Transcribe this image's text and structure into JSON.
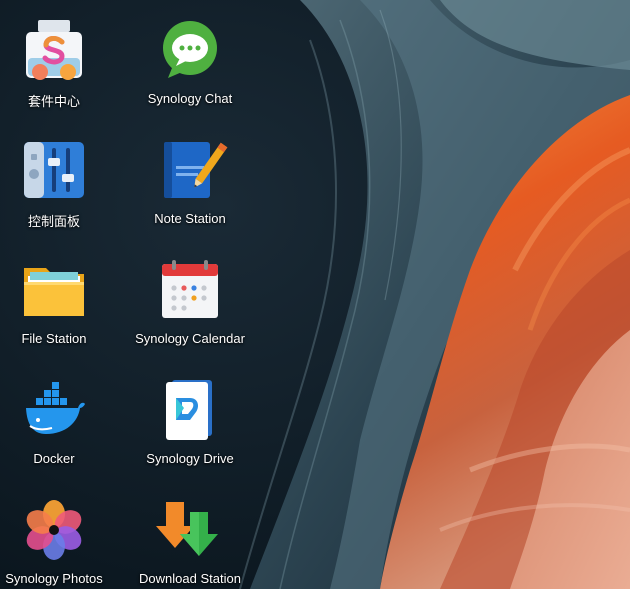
{
  "desktop": {
    "apps": [
      {
        "label": "套件中心",
        "icon": "package-center-icon"
      },
      {
        "label": "Synology Chat",
        "icon": "chat-bubble-icon"
      },
      {
        "label": "控制面板",
        "icon": "control-panel-sliders-icon"
      },
      {
        "label": "Note Station",
        "icon": "notebook-pencil-icon"
      },
      {
        "label": "File Station",
        "icon": "folder-icon"
      },
      {
        "label": "Synology Calendar",
        "icon": "calendar-icon"
      },
      {
        "label": "Docker",
        "icon": "docker-whale-icon"
      },
      {
        "label": "Synology Drive",
        "icon": "drive-icon"
      },
      {
        "label": "Synology Photos",
        "icon": "photos-flower-icon"
      },
      {
        "label": "Download Station",
        "icon": "download-arrows-icon"
      }
    ]
  },
  "colors": {
    "wallpaper_dark": "#0c1a24",
    "wallpaper_teal": "#3f5d6a",
    "wallpaper_orange": "#e8692a",
    "label_text": "#ffffff"
  }
}
